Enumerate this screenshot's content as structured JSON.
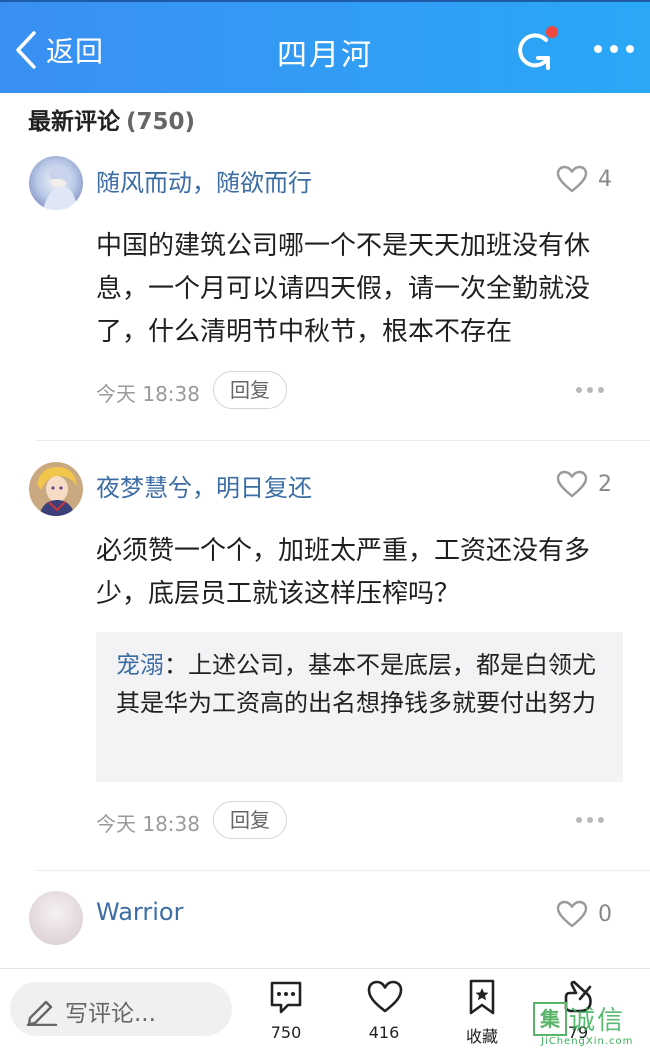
{
  "header": {
    "back_label": "返回",
    "title": "四月河",
    "accent_color": "#2f9bf5",
    "notification_dot_color": "#f0483e"
  },
  "section": {
    "title": "最新评论",
    "count": "(750)"
  },
  "comments": [
    {
      "username": "随风而动，随欲而行",
      "likes": "4",
      "body": "中国的建筑公司哪一个不是天天加班没有休息，一个月可以请四天假，请一次全勤就没了，什么清明节中秋节，根本不存在",
      "time": "今天 18:38",
      "reply_label": "回复"
    },
    {
      "username": "夜梦慧兮，明日复还",
      "likes": "2",
      "body": "必须赞一个个，加班太严重，工资还没有多少，底层员工就该这样压榨吗？",
      "quote": {
        "user": "宠溺",
        "separator": "：",
        "text": "上述公司，基本不是底层，都是白领尤其是华为工资高的出名想挣钱多就要付出努力"
      },
      "time": "今天 18:38",
      "reply_label": "回复"
    },
    {
      "username": "Warrior",
      "likes": "0"
    }
  ],
  "bottom_bar": {
    "write_placeholder": "写评论...",
    "comment_count": "750",
    "like_count": "416",
    "favorite_label": "收藏",
    "share_count": "79"
  },
  "watermark": {
    "box_char": "集",
    "text": "诚信",
    "sub": "JiChengXin.com"
  }
}
